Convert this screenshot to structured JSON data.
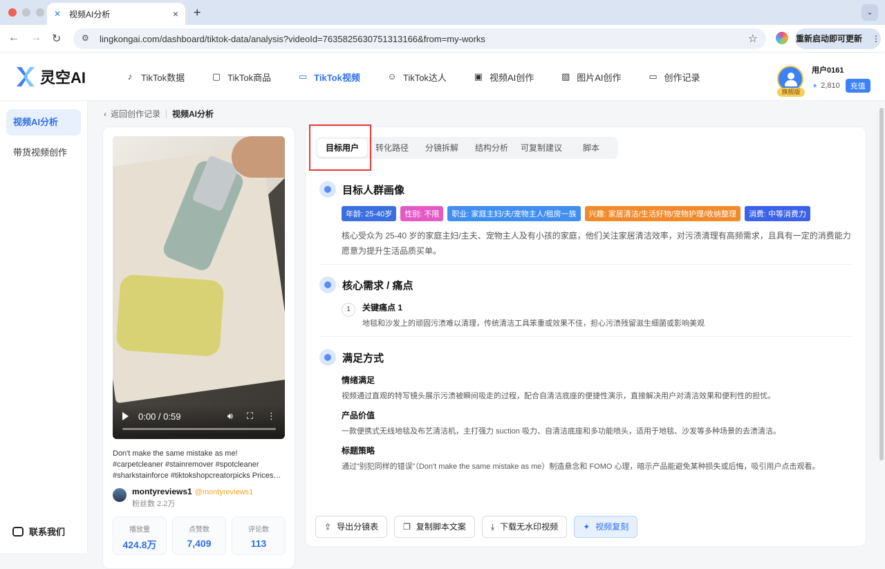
{
  "browser": {
    "tab_title": "视频AI分析",
    "tab_close": "×",
    "new_tab": "+",
    "tab_menu": "⌄",
    "url": "lingkongai.com/dashboard/tiktok-data/analysis?videoId=7635825630751313166&from=my-works",
    "update_label": "重新启动即可更新",
    "update_more": "⋮"
  },
  "header": {
    "logo_text": "灵空AI",
    "nav": [
      {
        "label": "TikTok数据",
        "icon": "music-note-icon",
        "glyph": "♪"
      },
      {
        "label": "TikTok商品",
        "icon": "shopping-bag-icon",
        "glyph": "▢"
      },
      {
        "label": "TikTok视频",
        "icon": "video-camera-icon",
        "glyph": "▭"
      },
      {
        "label": "TikTok达人",
        "icon": "users-icon",
        "glyph": "☺"
      },
      {
        "label": "视频AI创作",
        "icon": "video-create-icon",
        "glyph": "▣"
      },
      {
        "label": "图片AI创作",
        "icon": "image-icon",
        "glyph": "▨"
      },
      {
        "label": "创作记录",
        "icon": "folder-icon",
        "glyph": "▭"
      }
    ],
    "user": {
      "name": "用户0161",
      "badge": "旗舰版",
      "balance": "2,810",
      "recharge": "充值"
    }
  },
  "sidebar": {
    "items": [
      {
        "label": "视频AI分析"
      },
      {
        "label": "带货视频创作"
      }
    ],
    "contact": "联系我们"
  },
  "breadcrumb": {
    "back": "返回创作记录",
    "current": "视频AI分析"
  },
  "video": {
    "time": "0:00 / 0:59",
    "progress": 0,
    "description": "Don't make the same mistake as me! #carpetcleaner #stainremover #spotcleaner #sharkstainforce #tiktokshopcreatorpicks Prices and discounts may...",
    "author": "montyreviews1",
    "handle": "@montyreviews1",
    "fans": "粉丝数 2.2万",
    "stats": [
      {
        "label": "播放量",
        "value": "424.8万"
      },
      {
        "label": "点赞数",
        "value": "7,409"
      },
      {
        "label": "评论数",
        "value": "113"
      }
    ]
  },
  "tabs": [
    {
      "label": "目标用户"
    },
    {
      "label": "转化路径"
    },
    {
      "label": "分镜拆解"
    },
    {
      "label": "结构分析"
    },
    {
      "label": "可复制建议"
    },
    {
      "label": "脚本"
    }
  ],
  "persona": {
    "title": "目标人群画像",
    "tags": [
      {
        "label": "年龄: 25-40岁",
        "color": "#3b6fe0"
      },
      {
        "label": "性别: 不限",
        "color": "#e35ac5"
      },
      {
        "label": "职业: 家庭主妇/夫/宠物主人/租房一族",
        "color": "#3f8ef0"
      },
      {
        "label": "兴趣: 家居清洁/生活好物/宠物护理/收纳整理",
        "color": "#f08a2c"
      },
      {
        "label": "消费: 中等消费力",
        "color": "#3b62e8"
      }
    ],
    "text": "核心受众为 25-40 岁的家庭主妇/主夫、宠物主人及有小孩的家庭，他们关注家居清洁效率，对污渍清理有高频需求，且具有一定的消费能力愿意为提升生活品质买单。"
  },
  "needs": {
    "title": "核心需求 / 痛点",
    "items": [
      {
        "num": "1",
        "title": "关键痛点 1",
        "desc": "地毯和沙发上的顽固污渍难以清理，传统清洁工具笨重或效果不佳，担心污渍残留滋生细菌或影响美观"
      }
    ]
  },
  "satisfy": {
    "title": "满足方式",
    "items": [
      {
        "title": "情绪满足",
        "desc": "视频通过直观的特写镜头展示污渍被瞬间吸走的过程，配合自清洁底座的便捷性演示，直接解决用户对清洁效果和便利性的担忧。"
      },
      {
        "title": "产品价值",
        "desc": "一款便携式无线地毯及布艺清洁机，主打强力 suction 吸力、自清洁底座和多功能喷头，适用于地毯、沙发等多种场景的去渍清洁。"
      },
      {
        "title": "标题策略",
        "desc": "通过“别犯同样的错误”（Don't make the same mistake as me）制造悬念和 FOMO 心理，暗示产品能避免某种损失或后悔，吸引用户点击观看。"
      }
    ]
  },
  "actions": [
    {
      "label": "导出分镜表",
      "icon": "upload-icon",
      "glyph": "⇪"
    },
    {
      "label": "复制脚本文案",
      "icon": "copy-icon",
      "glyph": "❐"
    },
    {
      "label": "下载无水印视频",
      "icon": "download-icon",
      "glyph": "⤓"
    },
    {
      "label": "视频复刻",
      "icon": "sparkle-icon",
      "glyph": "✦"
    }
  ]
}
